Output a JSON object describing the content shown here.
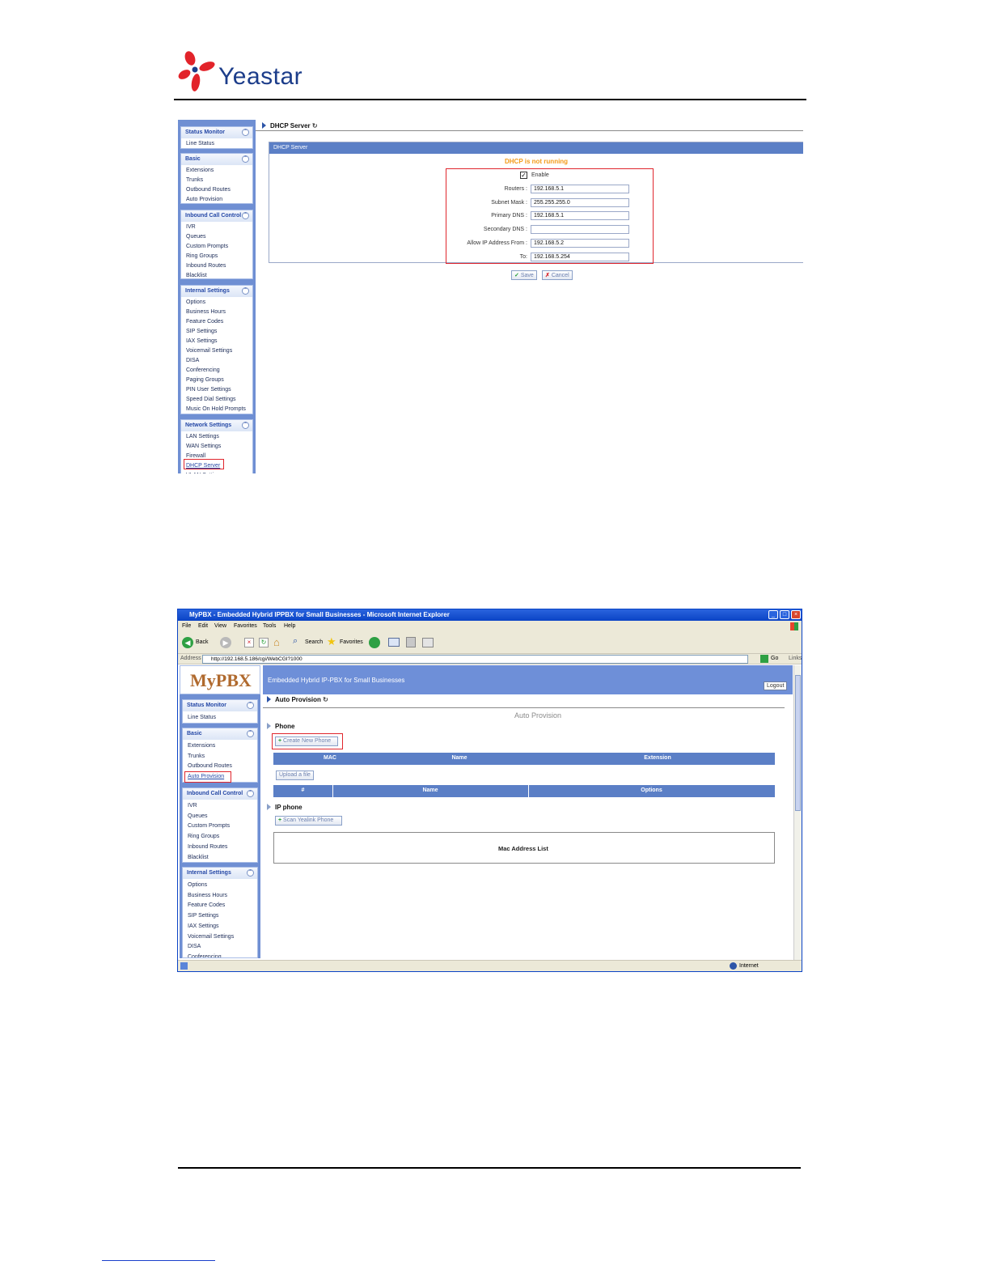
{
  "header": {
    "logo_text": "Yeastar"
  },
  "shot1": {
    "sidebar": [
      {
        "title": "Status Monitor",
        "items": [
          "Line Status"
        ]
      },
      {
        "title": "Basic",
        "items": [
          "Extensions",
          "Trunks",
          "Outbound Routes",
          "Auto Provision"
        ]
      },
      {
        "title": "Inbound Call Control",
        "items": [
          "IVR",
          "Queues",
          "Custom Prompts",
          "Ring Groups",
          "Inbound Routes",
          "Blacklist"
        ]
      },
      {
        "title": "Internal Settings",
        "items": [
          "Options",
          "Business Hours",
          "Feature Codes",
          "SIP Settings",
          "IAX Settings",
          "Voicemail Settings",
          "DISA",
          "Conferencing",
          "Paging Groups",
          "PIN User Settings",
          "Speed Dial Settings",
          "Music On Hold Prompts"
        ]
      },
      {
        "title": "Network Settings",
        "items": [
          "LAN Settings",
          "WAN Settings",
          "Firewall",
          "DHCP Server",
          "VLAN Settings"
        ]
      }
    ],
    "collapse_icon": "⌃",
    "breadcrumb": "DHCP Server",
    "panel_title": "DHCP Server",
    "status": "DHCP is not running",
    "status_color": "#f39a16",
    "enable_label": "Enable",
    "fields": [
      {
        "label": "Routers :",
        "value": "192.168.5.1"
      },
      {
        "label": "Subnet Mask :",
        "value": "255.255.255.0"
      },
      {
        "label": "Primary DNS :",
        "value": "192.168.5.1"
      },
      {
        "label": "Secondary DNS :",
        "value": ""
      },
      {
        "label": "Allow IP Address From :",
        "value": "192.168.5.2"
      },
      {
        "label": "To:",
        "value": "192.168.5.254"
      }
    ],
    "save_label": "Save",
    "cancel_label": "Cancel"
  },
  "shot2": {
    "window_title": "MyPBX - Embedded Hybrid IPPBX for Small Businesses - Microsoft Internet Explorer",
    "menu": [
      "File",
      "Edit",
      "View",
      "Favorites",
      "Tools",
      "Help"
    ],
    "toolbar": {
      "back": "Back",
      "search": "Search",
      "favorites": "Favorites"
    },
    "address_label": "Address",
    "address_value": "http://192.168.5.186/cgi/WebCGI?1000",
    "go_label": "Go",
    "links_label": "Links",
    "brand": "MyPBX",
    "banner": "Embedded Hybrid IP-PBX for Small Businesses",
    "logout": "Logout",
    "sidebar": [
      {
        "title": "Status Monitor",
        "items": [
          "Line Status"
        ]
      },
      {
        "title": "Basic",
        "items": [
          "Extensions",
          "Trunks",
          "Outbound Routes",
          "Auto Provision"
        ]
      },
      {
        "title": "Inbound Call Control",
        "items": [
          "IVR",
          "Queues",
          "Custom Prompts",
          "Ring Groups",
          "Inbound Routes",
          "Blacklist"
        ]
      },
      {
        "title": "Internal Settings",
        "items": [
          "Options",
          "Business Hours",
          "Feature Codes",
          "SIP Settings",
          "IAX Settings",
          "Voicemail Settings",
          "DISA",
          "Conferencing"
        ]
      }
    ],
    "breadcrumb": "Auto Provision",
    "page_title": "Auto Provision",
    "phone_section": "Phone",
    "create_button": "Create New Phone",
    "phone_columns": [
      "MAC",
      "Name",
      "Extension"
    ],
    "upload_button": "Upload a file",
    "file_columns": [
      "#",
      "Name",
      "Options"
    ],
    "ipphone_section": "IP phone",
    "scan_button": "Scan Yealink Phone",
    "mac_list_label": "Mac Address List",
    "status_zone": "Internet"
  }
}
